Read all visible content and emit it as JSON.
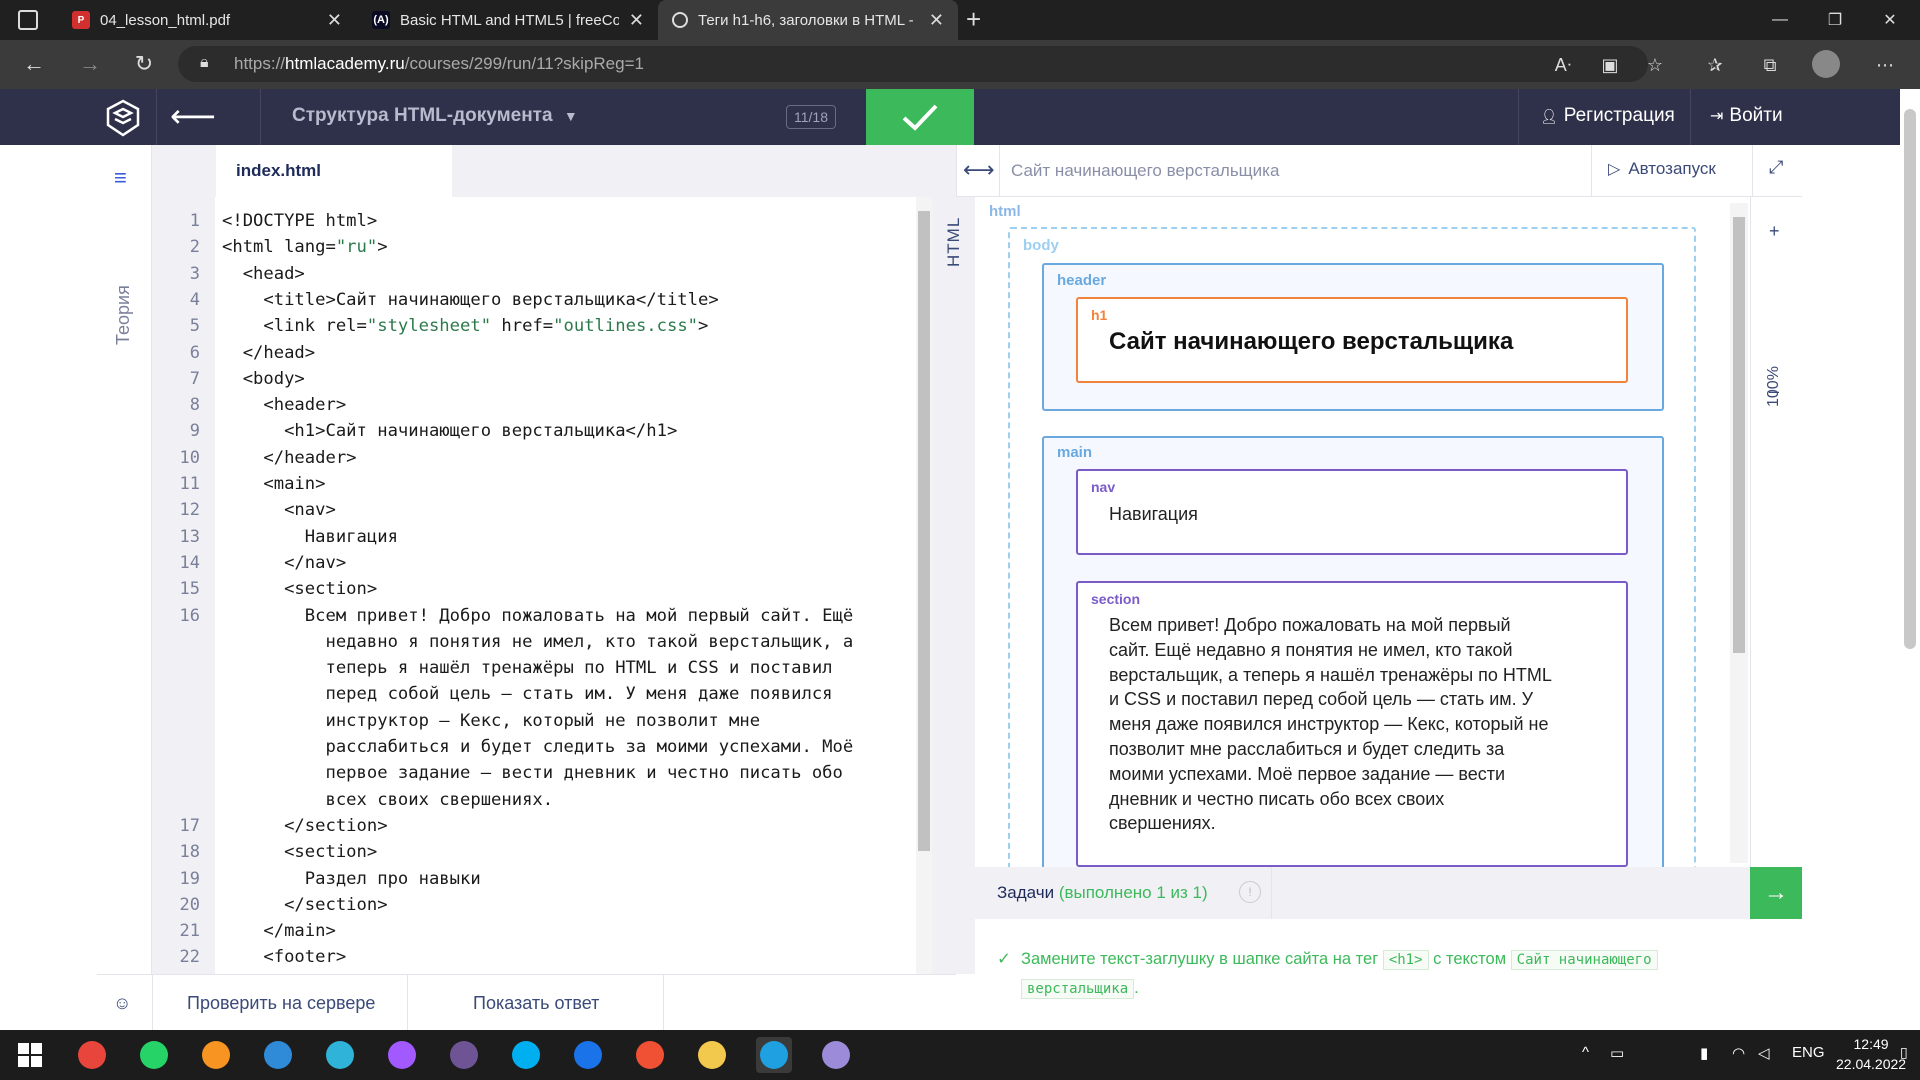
{
  "browser": {
    "tabs": [
      {
        "title": "04_lesson_html.pdf",
        "favicon": "pdf-icon",
        "active": false
      },
      {
        "title": "Basic HTML and HTML5 | freeCo",
        "favicon": "freecodecamp-icon",
        "active": false
      },
      {
        "title": "Теги h1-h6, заголовки в HTML -",
        "favicon": "htmlacademy-icon",
        "active": true
      }
    ],
    "url_prefix": "https://",
    "url_host": "htmlacademy.ru",
    "url_path": "/courses/299/run/11?skipReg=1"
  },
  "site_header": {
    "course_title": "Структура HTML-документа",
    "progress": "11/18",
    "register_label": "Регистрация",
    "login_label": "Войти"
  },
  "rail": {
    "theory_label": "Теория"
  },
  "editor": {
    "file_tab": "index.html",
    "lines": [
      {
        "n": "1",
        "text": "<!DOCTYPE html>"
      },
      {
        "n": "2",
        "text": "<html lang=\"ru\">"
      },
      {
        "n": "3",
        "text": "  <head>"
      },
      {
        "n": "4",
        "text": "    <title>Сайт начинающего верстальщика</title>"
      },
      {
        "n": "5",
        "text": "    <link rel=\"stylesheet\" href=\"outlines.css\">"
      },
      {
        "n": "6",
        "text": "  </head>"
      },
      {
        "n": "7",
        "text": "  <body>"
      },
      {
        "n": "8",
        "text": "    <header>"
      },
      {
        "n": "9",
        "text": "      <h1>Сайт начинающего верстальщика</h1>"
      },
      {
        "n": "10",
        "text": "    </header>"
      },
      {
        "n": "11",
        "text": "    <main>"
      },
      {
        "n": "12",
        "text": "      <nav>"
      },
      {
        "n": "13",
        "text": "        Навигация"
      },
      {
        "n": "14",
        "text": "      </nav>"
      },
      {
        "n": "15",
        "text": "      <section>"
      },
      {
        "n": "16",
        "text": "        Всем привет! Добро пожаловать на мой первый сайт. Ещё"
      },
      {
        "n": "",
        "text": "          недавно я понятия не имел, кто такой верстальщик, а"
      },
      {
        "n": "",
        "text": "          теперь я нашёл тренажёры по HTML и CSS и поставил"
      },
      {
        "n": "",
        "text": "          перед собой цель — стать им. У меня даже появился"
      },
      {
        "n": "",
        "text": "          инструктор — Кекс, который не позволит мне"
      },
      {
        "n": "",
        "text": "          расслабиться и будет следить за моими успехами. Моё"
      },
      {
        "n": "",
        "text": "          первое задание — вести дневник и честно писать обо"
      },
      {
        "n": "",
        "text": "          всех своих свершениях."
      },
      {
        "n": "17",
        "text": "      </section>"
      },
      {
        "n": "18",
        "text": "      <section>"
      },
      {
        "n": "19",
        "text": "        Раздел про навыки"
      },
      {
        "n": "20",
        "text": "      </section>"
      },
      {
        "n": "21",
        "text": "    </main>"
      },
      {
        "n": "22",
        "text": "    <footer>"
      }
    ],
    "check_server_label": "Проверить на сервере",
    "show_answer_label": "Показать ответ",
    "html_label": "HTML"
  },
  "preview": {
    "title": "Сайт начинающего верстальщика",
    "autorun_label": "Автозапуск",
    "zoom_label": "100%",
    "zoom_in": "+",
    "zoom_out": "–",
    "labels": {
      "html": "html",
      "body": "body",
      "header": "header",
      "h1": "h1",
      "main": "main",
      "nav": "nav",
      "section": "section"
    },
    "h1_text": "Сайт начинающего верстальщика",
    "nav_text": "Навигация",
    "section_lines": [
      "Всем привет! Добро пожаловать на мой первый",
      "сайт. Ещё недавно я понятия не имел, кто такой",
      "верстальщик, а теперь я нашёл тренажёры по HTML",
      "и CSS и поставил перед собой цель — стать им. У",
      "меня даже появился инструктор — Кекс, который не",
      "позволит мне расслабиться и будет следить за",
      "моими успехами. Моё первое задание — вести",
      "дневник и честно писать обо всех своих",
      "свершениях."
    ],
    "colors": {
      "html": "#8bb8e8",
      "body": "#9ccff0",
      "header": "#6aa8e0",
      "h1": "#f0843c",
      "main": "#6aa8e0",
      "nav": "#7a5bc8",
      "section": "#7a5bc8"
    }
  },
  "tasks": {
    "title": "Задачи",
    "count": "(выполнено 1 из 1)",
    "item_prefix": "Замените текст-заглушку в шапке сайта на тег",
    "item_tag": "<h1>",
    "item_middle": "с текстом",
    "item_code_1": "Сайт начинающего",
    "item_code_2": "верстальщика",
    "item_suffix": "."
  },
  "taskbar": {
    "lang": "ENG",
    "time": "12:49",
    "date": "22.04.2022",
    "apps": [
      "start-icon",
      "chrome-icon",
      "whatsapp-icon",
      "sublime-icon",
      "vscode-icon",
      "app-icon",
      "figma-icon",
      "github-icon",
      "skype-icon",
      "maps-icon",
      "git-icon",
      "explorer-icon",
      "edge-icon",
      "paint-icon"
    ]
  }
}
